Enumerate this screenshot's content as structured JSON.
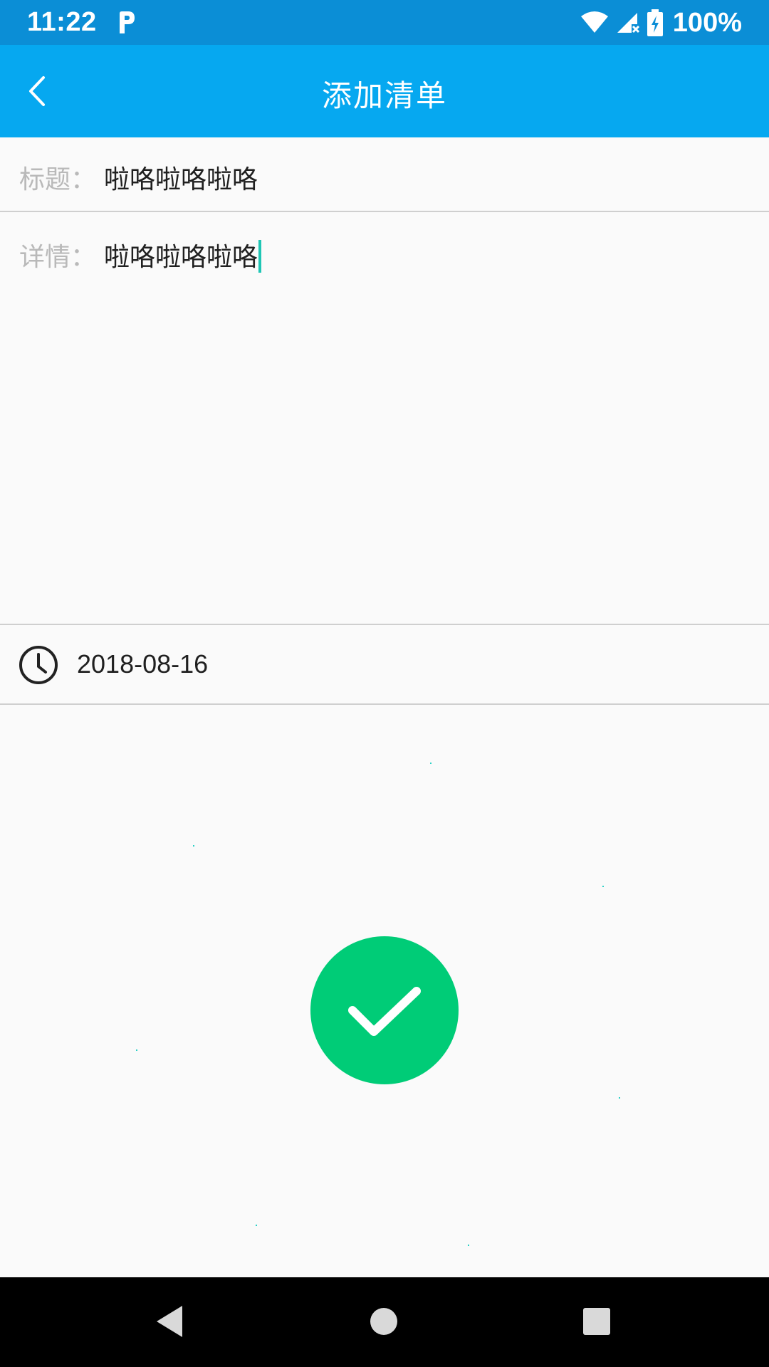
{
  "status_bar": {
    "time": "11:22",
    "battery_percent": "100%",
    "icons": [
      "p-icon",
      "wifi-icon",
      "signal-icon",
      "battery-charging-icon"
    ]
  },
  "app_bar": {
    "title": "添加清单",
    "back_icon": "chevron-left-icon"
  },
  "form": {
    "title_label": "标题：",
    "title_value": "啦咯啦咯啦咯",
    "detail_label": "详情：",
    "detail_value": "啦咯啦咯啦咯",
    "date_icon": "clock-icon",
    "date_value": "2018-08-16"
  },
  "confirm_button": {
    "icon": "check-icon",
    "color": "#00cc77"
  },
  "colors": {
    "status_bar": "#0b8ed6",
    "app_bar": "#06a8f0",
    "cursor": "#1fc6b5"
  },
  "nav_bar": {
    "icons": [
      "nav-back-icon",
      "nav-home-icon",
      "nav-recent-icon"
    ]
  }
}
